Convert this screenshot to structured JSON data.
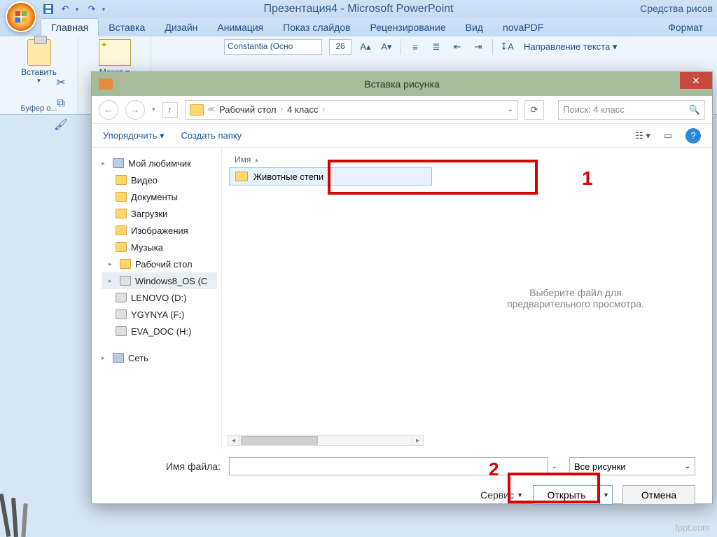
{
  "app": {
    "title": "Презентация4 - Microsoft PowerPoint",
    "context_tools": "Средства рисов"
  },
  "tabs": {
    "home": "Главная",
    "insert": "Вставка",
    "design": "Дизайн",
    "anim": "Анимация",
    "show": "Показ слайдов",
    "review": "Рецензирование",
    "view": "Вид",
    "novapdf": "novaPDF",
    "format": "Формат"
  },
  "ribbon": {
    "paste": "Вставить",
    "clipboard_group": "Буфер о...",
    "layout": "Макет ▾",
    "font_name": "Constantia (Осно",
    "font_size": "26",
    "text_direction": "Направление текста ▾"
  },
  "dialog": {
    "title": "Вставка рисунка",
    "breadcrumb": {
      "a": "Рабочий стол",
      "b": "4 класс"
    },
    "search_placeholder": "Поиск: 4 класс",
    "organize": "Упорядочить ▾",
    "new_folder": "Создать папку",
    "column_name": "Имя",
    "tree": {
      "fav": "Мой любимчик",
      "video": "Видео",
      "docs": "Документы",
      "downloads": "Загрузки",
      "images": "Изображения",
      "music": "Музыка",
      "desktop": "Рабочий стол",
      "win8": "Windows8_OS (C",
      "lenovo": "LENOVO (D:)",
      "ygynya": "YGYNYA (F:)",
      "evadoc": "EVA_DOC (H:)",
      "network": "Сеть"
    },
    "file_selected": "Животные степи",
    "preview_hint": "Выберите файл для предварительного просмотра.",
    "filename_label": "Имя файла:",
    "filter": "Все рисунки",
    "tools": "Сервис",
    "open": "Открыть",
    "cancel": "Отмена"
  },
  "annotations": {
    "one": "1",
    "two": "2"
  },
  "watermark": "fppt.com"
}
